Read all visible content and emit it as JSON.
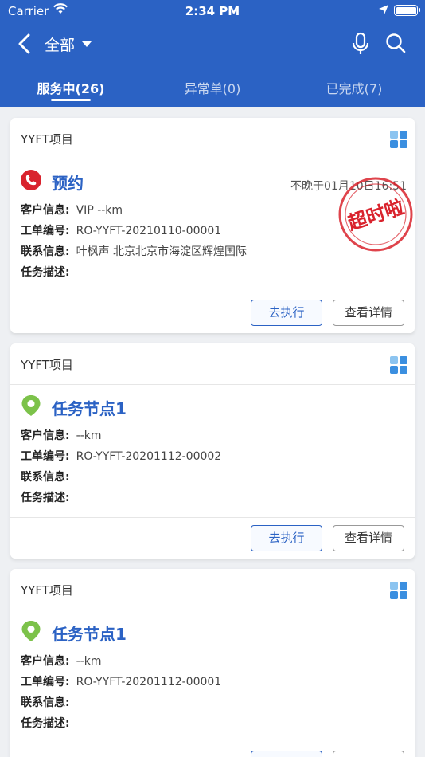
{
  "status_bar": {
    "carrier": "Carrier",
    "time": "2:34 PM"
  },
  "nav": {
    "filter_label": "全部"
  },
  "tabs": [
    {
      "label": "服务中(26)",
      "active": true
    },
    {
      "label": "异常单(0)",
      "active": false
    },
    {
      "label": "已完成(7)",
      "active": false
    }
  ],
  "labels": {
    "customer": "客户信息:",
    "order_no": "工单编号:",
    "contact": "联系信息:",
    "description": "任务描述:",
    "execute_button": "去执行",
    "detail_button": "查看详情"
  },
  "cards": [
    {
      "project": "YYFT项目",
      "task": "预约",
      "task_icon": "phone-icon",
      "deadline": "不晚于01月10日16:51",
      "stamp_text": "超时啦",
      "customer": "VIP --km",
      "order_no": "RO-YYFT-20210110-00001",
      "contact": "叶枫声  北京北京市海淀区辉煌国际",
      "description": ""
    },
    {
      "project": "YYFT项目",
      "task": "任务节点1",
      "task_icon": "location-pin-icon",
      "customer": "--km",
      "order_no": "RO-YYFT-20201112-00002",
      "contact": "",
      "description": ""
    },
    {
      "project": "YYFT项目",
      "task": "任务节点1",
      "task_icon": "location-pin-icon",
      "customer": "--km",
      "order_no": "RO-YYFT-20201112-00001",
      "contact": "",
      "description": ""
    }
  ],
  "colors": {
    "primary": "#2b62c4",
    "stamp_red": "#d9232d",
    "pin_green": "#7cc24a",
    "grid_blue": "#3b8fe0",
    "grid_light": "#8cc4f0"
  }
}
